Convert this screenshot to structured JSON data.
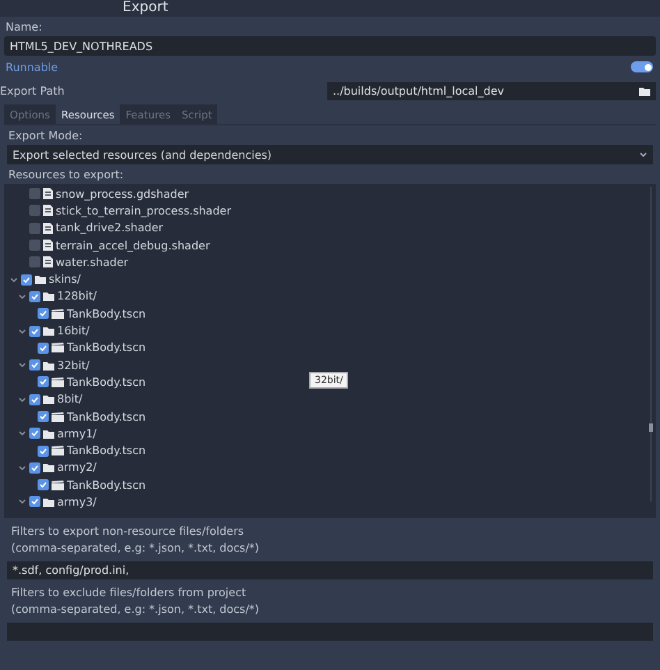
{
  "window": {
    "title": "Export"
  },
  "name": {
    "label": "Name:",
    "value": "HTML5_DEV_NOTHREADS"
  },
  "runnable": {
    "label": "Runnable",
    "on": true
  },
  "export_path": {
    "label": "Export Path",
    "value": "../builds/output/html_local_dev"
  },
  "tabs": [
    {
      "label": "Options",
      "selected": false
    },
    {
      "label": "Resources",
      "selected": true
    },
    {
      "label": "Features",
      "selected": false
    },
    {
      "label": "Script",
      "selected": false
    }
  ],
  "export_mode": {
    "label": "Export Mode:",
    "value": "Export selected resources (and dependencies)"
  },
  "resources": {
    "label": "Resources to export:",
    "tree": [
      {
        "children": [
          {
            "label": "snow_process.gdshader",
            "kind": "shader",
            "checked": false
          },
          {
            "label": "stick_to_terrain_process.shader",
            "kind": "shader",
            "checked": false
          },
          {
            "label": "tank_drive2.shader",
            "kind": "shader",
            "checked": false
          },
          {
            "label": "terrain_accel_debug.shader",
            "kind": "shader",
            "checked": false
          },
          {
            "label": "water.shader",
            "kind": "shader",
            "checked": false
          }
        ]
      },
      {
        "label": "skins/",
        "kind": "folder",
        "checked": true,
        "expanded": true,
        "children": [
          {
            "label": "128bit/",
            "kind": "folder",
            "checked": true,
            "expanded": true,
            "children": [
              {
                "label": "TankBody.tscn",
                "kind": "scene",
                "checked": true
              }
            ]
          },
          {
            "label": "16bit/",
            "kind": "folder",
            "checked": true,
            "expanded": true,
            "children": [
              {
                "label": "TankBody.tscn",
                "kind": "scene",
                "checked": true
              }
            ]
          },
          {
            "label": "32bit/",
            "kind": "folder",
            "checked": true,
            "expanded": true,
            "children": [
              {
                "label": "TankBody.tscn",
                "kind": "scene",
                "checked": true
              }
            ]
          },
          {
            "label": "8bit/",
            "kind": "folder",
            "checked": true,
            "expanded": true,
            "children": [
              {
                "label": "TankBody.tscn",
                "kind": "scene",
                "checked": true
              }
            ]
          },
          {
            "label": "army1/",
            "kind": "folder",
            "checked": true,
            "expanded": true,
            "children": [
              {
                "label": "TankBody.tscn",
                "kind": "scene",
                "checked": true
              }
            ]
          },
          {
            "label": "army2/",
            "kind": "folder",
            "checked": true,
            "expanded": true,
            "children": [
              {
                "label": "TankBody.tscn",
                "kind": "scene",
                "checked": true
              }
            ]
          },
          {
            "label": "army3/",
            "kind": "folder",
            "checked": true,
            "expanded": true
          }
        ]
      }
    ],
    "tooltip": "32bit/"
  },
  "include_filters": {
    "label": "Filters to export non-resource files/folders",
    "hint": "(comma-separated, e.g: *.json, *.txt, docs/*)",
    "value": "*.sdf, config/prod.ini,"
  },
  "exclude_filters": {
    "label": "Filters to exclude files/folders from project",
    "hint": "(comma-separated, e.g: *.json, *.txt, docs/*)"
  }
}
